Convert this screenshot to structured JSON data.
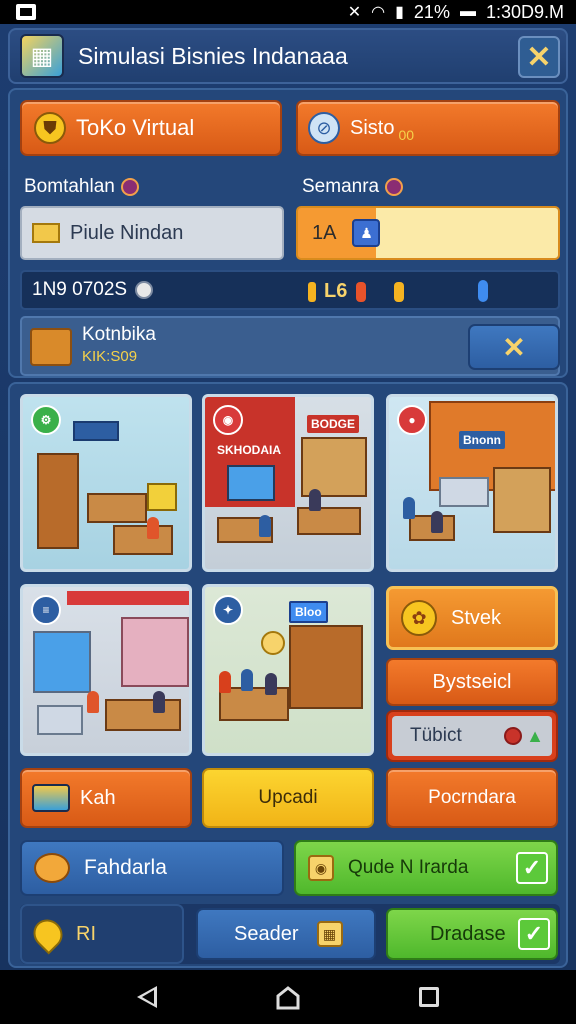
{
  "statusbar": {
    "battery": "21%",
    "time": "1:30D9.M"
  },
  "header": {
    "title": "Simulasi Bisnies Indanaaa",
    "close": "✕"
  },
  "tabs": {
    "toko": "ToKo Virtual",
    "sisto": "Sisto",
    "sisto_sub": "00"
  },
  "labels": {
    "left": "Bomtahlan",
    "right": "Semanra"
  },
  "fields": {
    "name_value": "Piule Nindan",
    "qty_value": "1A"
  },
  "stats": {
    "money": "1N9 0702S",
    "level": "L6"
  },
  "kotak": {
    "title": "Kotnbika",
    "subtitle": "KIK:S09",
    "button": "✕"
  },
  "scenes": {
    "sign1": "SKHODAIA",
    "sign2": "BODGE",
    "sign3": "Bloo",
    "sign4": "Bnonn"
  },
  "side": {
    "stvek": "Stvek",
    "bystseicl": "Bystseicl",
    "tubict": "Tübict"
  },
  "row1": {
    "kah": "Kah",
    "upcadi": "Upcadi",
    "pocrndara": "Pocrndara"
  },
  "row2": {
    "fahdarla": "Fahdarla",
    "qude": "Qude N Irarda"
  },
  "row3": {
    "ri": "RI",
    "seader": "Seader",
    "dradase": "Dradase"
  },
  "colors": {
    "orange": "#e86a20",
    "yellow": "#f7c520",
    "green": "#5cc93a",
    "blue": "#2f66b0",
    "panel": "#24477a"
  },
  "icons": [
    "store-icon",
    "compass-icon",
    "envelope-icon",
    "box-icon",
    "gear-icon",
    "bag-icon",
    "coins-icon",
    "map-pin-icon",
    "check-icon",
    "close-icon"
  ]
}
